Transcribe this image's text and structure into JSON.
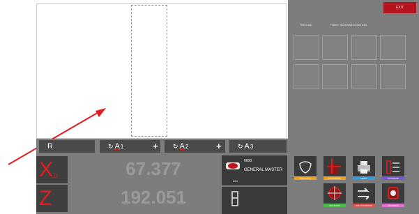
{
  "header": {
    "exit_label": "EXIT",
    "info_left": "Tinted AG",
    "info_right": "Frame: SCHWARZ/STATION"
  },
  "fields": {
    "radius": {
      "label": "R"
    },
    "a1": {
      "rot": "↻",
      "letter": "A",
      "sub": "1",
      "plus": "+"
    },
    "a2": {
      "rot": "↻",
      "letter": "A",
      "sub": "2",
      "plus": "+"
    },
    "a3": {
      "rot": "↻",
      "letter": "A",
      "sub": "3"
    }
  },
  "axes": {
    "x": {
      "letter": "X",
      "sub": "D",
      "value": "67.377"
    },
    "z": {
      "letter": "Z",
      "value": "192.051"
    }
  },
  "program": {
    "id": "0000",
    "name": "GENERAL MASTER",
    "unit": "mm"
  },
  "toolbar": {
    "row1": [
      {
        "label": "FUNCTION",
        "icon": "lens-icon",
        "strip_color": "#f0a020"
      },
      {
        "label": "FUNCTIONS",
        "icon": "edge-icon",
        "strip_color": "#f0a020"
      },
      {
        "label": "PRINT",
        "icon": "printer-icon",
        "strip_color": "#3b9bd9"
      },
      {
        "label": "DATABASE",
        "icon": "list-icon",
        "strip_color": "#7a5ad8"
      }
    ],
    "row2": [
      {
        "label": "NETWORK",
        "icon": "target-icon",
        "strip_color": "#4cb94c"
      },
      {
        "label": "DATA TRANSFER",
        "icon": "transfer-icon",
        "strip_color": "#d9534f"
      },
      {
        "label": "SETTINGS",
        "icon": "settings-icon",
        "strip_color": "#e070d0"
      }
    ]
  },
  "colors": {
    "panel": "#7d7d7d",
    "accent_red": "#e31c1c",
    "exit_red": "#b3141e"
  }
}
